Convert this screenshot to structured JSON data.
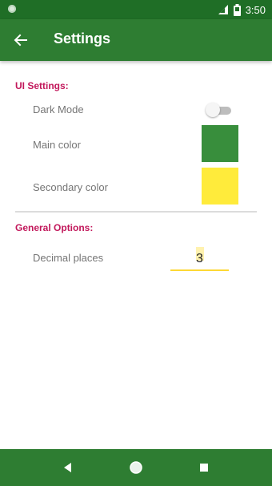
{
  "status_bar": {
    "time": "3:50"
  },
  "app_bar": {
    "title": "Settings"
  },
  "sections": {
    "ui": {
      "header": "UI Settings:",
      "dark_mode": {
        "label": "Dark Mode",
        "enabled": false
      },
      "main_color": {
        "label": "Main color",
        "color": "#388e3c"
      },
      "secondary_color": {
        "label": "Secondary color",
        "color": "#ffeb3b"
      }
    },
    "general": {
      "header": "General Options:",
      "decimal_places": {
        "label": "Decimal places",
        "value": "3"
      }
    }
  },
  "icons": {
    "back": "arrow-left-icon",
    "nav_back": "triangle-back-icon",
    "nav_home": "circle-home-icon",
    "nav_recents": "square-recents-icon"
  },
  "colors": {
    "status_bar": "#1f6e26",
    "app_bar": "#2e7d32",
    "accent": "#c2185b"
  }
}
